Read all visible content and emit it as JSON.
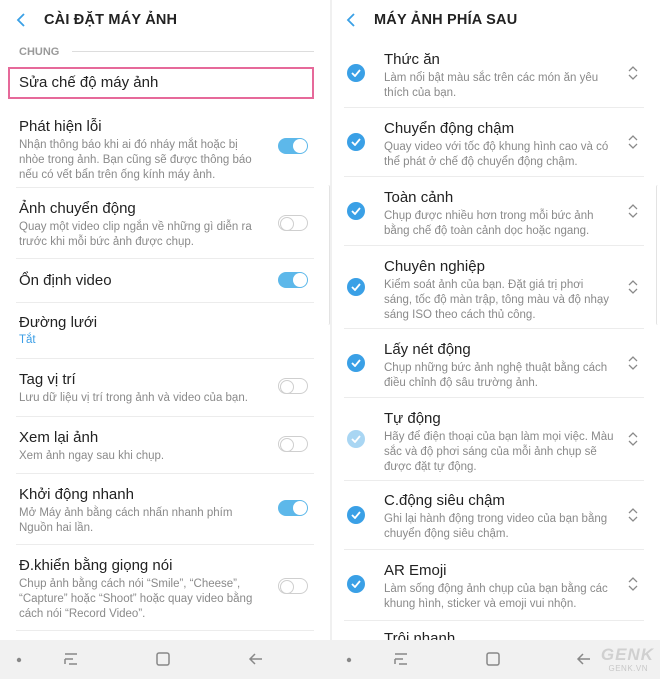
{
  "left": {
    "title": "CÀI ĐẶT MÁY ẢNH",
    "section": "CHUNG",
    "highlighted_item": "Sửa chế độ máy ảnh",
    "items": [
      {
        "title": "Phát hiện lỗi",
        "desc": "Nhận thông báo khi ai đó nháy mắt hoặc bị nhòe trong ảnh. Bạn cũng sẽ được thông báo nếu có vết bẩn trên ống kính máy ảnh.",
        "toggle": "on"
      },
      {
        "title": "Ảnh chuyển động",
        "desc": "Quay một video clip ngắn về những gì diễn ra trước khi mỗi bức ảnh được chụp.",
        "toggle": "off"
      },
      {
        "title": "Ổn định video",
        "toggle": "on"
      },
      {
        "title": "Đường lưới",
        "value": "Tắt"
      },
      {
        "title": "Tag vị trí",
        "desc": "Lưu dữ liệu vị trí trong ảnh và video của bạn.",
        "toggle": "off"
      },
      {
        "title": "Xem lại ảnh",
        "desc": "Xem ảnh ngay sau khi chụp.",
        "toggle": "off"
      },
      {
        "title": "Khởi động nhanh",
        "desc": "Mở Máy ảnh bằng cách nhấn nhanh phím Nguồn hai lần.",
        "toggle": "on"
      },
      {
        "title": "Đ.khiển bằng giọng nói",
        "desc": "Chụp ảnh bằng cách nói “Smile”, “Cheese”, “Capture” hoặc “Shoot” hoặc quay video bằng cách nói “Record Video”.",
        "toggle": "off"
      }
    ]
  },
  "right": {
    "title": "MÁY ẢNH PHÍA SAU",
    "items": [
      {
        "title": "Thức ăn",
        "desc": "Làm nổi bật màu sắc trên các món ăn yêu thích của bạn.",
        "checked": true
      },
      {
        "title": "Chuyển động chậm",
        "desc": "Quay video với tốc độ khung hình cao và có thể phát ở chế độ chuyển động chậm.",
        "checked": true
      },
      {
        "title": "Toàn cảnh",
        "desc": "Chụp được nhiều hơn trong mỗi bức ảnh bằng chế độ toàn cảnh dọc hoặc ngang.",
        "checked": true
      },
      {
        "title": "Chuyên nghiệp",
        "desc": "Kiểm soát ảnh của bạn. Đặt giá trị phơi sáng, tốc độ màn trập, tông màu và độ nhạy sáng ISO theo cách thủ công.",
        "checked": true
      },
      {
        "title": "Lấy nét động",
        "desc": "Chụp những bức ảnh nghệ thuật bằng cách điều chỉnh độ sâu trường ảnh.",
        "checked": true
      },
      {
        "title": "Tự động",
        "desc": "Hãy để điện thoại của bạn làm mọi việc. Màu sắc và độ phơi sáng của mỗi ảnh chụp sẽ được đặt tự động.",
        "checked": true
      },
      {
        "title": "C.động siêu chậm",
        "desc": "Ghi lại hành động trong video của bạn bằng chuyển động siêu chậm.",
        "checked": true
      },
      {
        "title": "AR Emoji",
        "desc": "Làm sống động ảnh chụp của bạn bằng các khung hình, sticker và emoji vui nhộn.",
        "checked": true
      },
      {
        "title": "Trôi nhanh"
      }
    ]
  },
  "watermark": {
    "brand": "GENK",
    "site": "GENK.VN"
  },
  "colors": {
    "accent": "#3aa0e6",
    "toggle_on": "#5db8ea",
    "highlight_border": "#e6699a"
  }
}
